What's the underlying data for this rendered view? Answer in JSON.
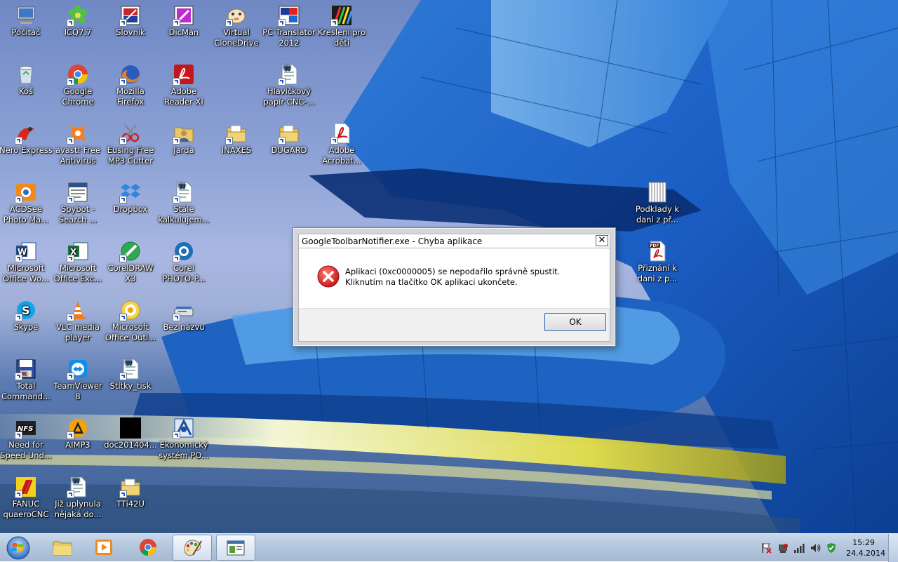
{
  "desktop": {
    "icons": [
      {
        "label": "Počítač",
        "icon": "computer-icon"
      },
      {
        "label": "ICQ7.7",
        "icon": "icq-flower-icon"
      },
      {
        "label": "Slovník",
        "icon": "dictionary-icon"
      },
      {
        "label": "DicMan",
        "icon": "dicman-icon"
      },
      {
        "label": "Virtual\nCloneDrive",
        "icon": "clonedrive-sheep-icon"
      },
      {
        "label": "PC Translator\n2012",
        "icon": "translator-flags-icon"
      },
      {
        "label": "Kreslení pro\nděti",
        "icon": "drawing-pencils-icon"
      },
      {
        "label": "Koš",
        "icon": "recycle-bin-icon"
      },
      {
        "label": "Google\nChrome",
        "icon": "chrome-icon"
      },
      {
        "label": "Mozilla\nFirefox",
        "icon": "firefox-icon"
      },
      {
        "label": "Adobe\nReader XI",
        "icon": "adobe-reader-icon"
      },
      {
        "label": "Hlavičkový\npapír CNC-...",
        "icon": "word-document-icon"
      },
      {
        "label": "Nero Express",
        "icon": "nero-icon"
      },
      {
        "label": "avast! Free\nAntivirus",
        "icon": "avast-icon"
      },
      {
        "label": "Eusing Free\nMP3 Cutter",
        "icon": "mp3-cutter-icon"
      },
      {
        "label": "Jarda",
        "icon": "user-folder-icon"
      },
      {
        "label": "INAXES",
        "icon": "folder-icon"
      },
      {
        "label": "DUGARD",
        "icon": "folder-icon"
      },
      {
        "label": "Adobe\nAcrobat...",
        "icon": "adobe-acrobat-icon"
      },
      {
        "label": "ACDSee\nPhoto Ma...",
        "icon": "acdsee-icon"
      },
      {
        "label": "Spybot -\nSearch ...",
        "icon": "spybot-icon"
      },
      {
        "label": "Dropbox",
        "icon": "dropbox-icon"
      },
      {
        "label": "Stále\nkalkulujem...",
        "icon": "word-document-icon"
      },
      {
        "label": "Podklady k\ndani z př...",
        "icon": "archive-document-icon"
      },
      {
        "label": "Microsoft\nOffice Wo...",
        "icon": "ms-word-icon"
      },
      {
        "label": "Microsoft\nOffice Exc...",
        "icon": "ms-excel-icon"
      },
      {
        "label": "CorelDRAW\nX3",
        "icon": "coreldraw-icon"
      },
      {
        "label": "Corel\nPHOTO-P...",
        "icon": "corel-photopaint-icon"
      },
      {
        "label": "Přiznání k\ndani z p...",
        "icon": "pdf-document-icon"
      },
      {
        "label": "Skype",
        "icon": "skype-icon"
      },
      {
        "label": "VLC media\nplayer",
        "icon": "vlc-cone-icon"
      },
      {
        "label": "Microsoft\nOffice Outl...",
        "icon": "ms-outlook-icon"
      },
      {
        "label": "Bez názvu",
        "icon": "scanner-icon"
      },
      {
        "label": "Total\nCommand...",
        "icon": "total-commander-icon"
      },
      {
        "label": "TeamViewer\n8",
        "icon": "teamviewer-icon"
      },
      {
        "label": "Štítky_tisk",
        "icon": "word-document-icon"
      },
      {
        "label": "Need for\nSpeed Und...",
        "icon": "nfs-icon"
      },
      {
        "label": "AIMP3",
        "icon": "aimp-icon"
      },
      {
        "label": "doc201404...",
        "icon": "black-file-icon"
      },
      {
        "label": "Ekonomický\nsystém PO...",
        "icon": "economic-system-icon"
      },
      {
        "label": "FANUC\nquaeroCNC",
        "icon": "fanuc-icon"
      },
      {
        "label": "Již uplynula\nnějaká do...",
        "icon": "word-document-icon"
      },
      {
        "label": "TTi42U",
        "icon": "folder-icon"
      }
    ]
  },
  "dialog": {
    "title": "GoogleToolbarNotifier.exe - Chyba aplikace",
    "close_label": "✕",
    "message": "Aplikaci (0xc0000005) se nepodařilo správně spustit. Kliknutím na tlačítko OK aplikaci ukončete.",
    "ok_label": "OK",
    "icon": "error-x-icon"
  },
  "taskbar": {
    "start_icon": "windows-start-orb-icon",
    "pinned": [
      {
        "icon": "explorer-folder-icon",
        "active": false
      },
      {
        "icon": "media-player-icon",
        "active": false
      },
      {
        "icon": "chrome-icon",
        "active": false
      },
      {
        "icon": "paint-palette-icon",
        "active": true
      },
      {
        "icon": "application-window-icon",
        "active": true
      }
    ],
    "tray_icons": [
      "flag-icon",
      "network-adapter-icon",
      "signal-bars-icon",
      "volume-icon",
      "shield-check-icon"
    ],
    "clock": {
      "time": "15:29",
      "date": "24.4.2014"
    }
  }
}
